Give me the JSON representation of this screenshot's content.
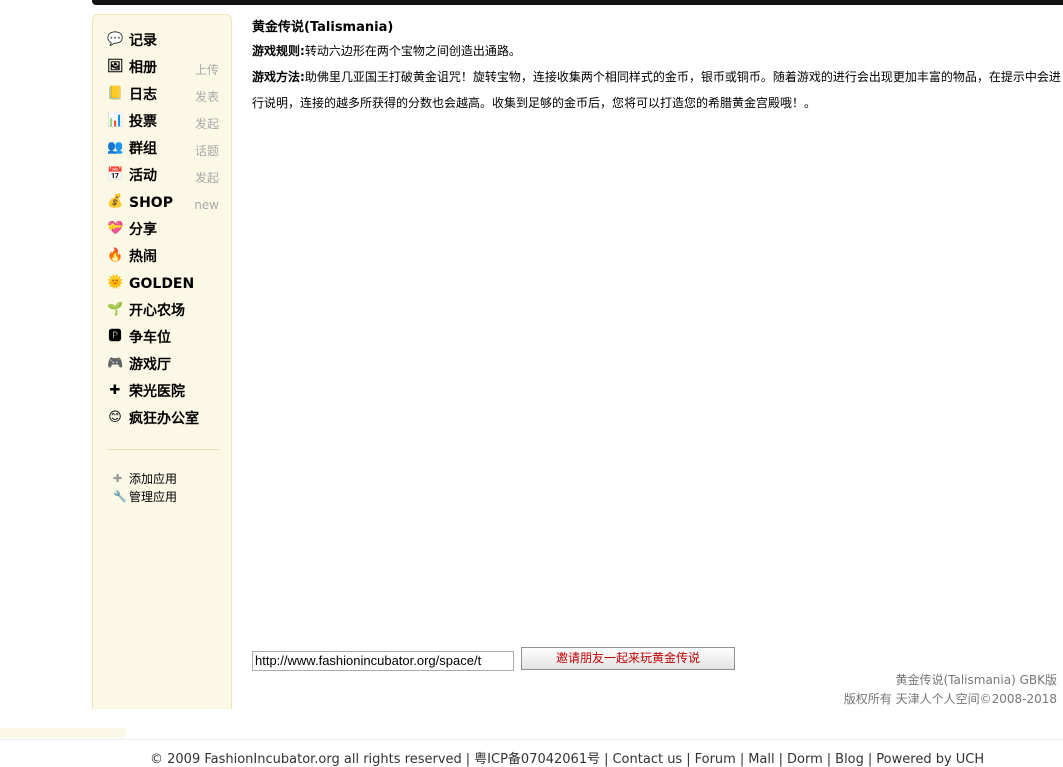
{
  "sidebar": {
    "items": [
      {
        "label": "记录",
        "sub": "",
        "icon": "chat-bubble-icon",
        "glyph": "💬"
      },
      {
        "label": "相册",
        "sub": "上传",
        "icon": "photo-icon",
        "glyph": "🖼"
      },
      {
        "label": "日志",
        "sub": "发表",
        "icon": "notebook-icon",
        "glyph": "📒"
      },
      {
        "label": "投票",
        "sub": "发起",
        "icon": "bar-chart-icon",
        "glyph": "📊"
      },
      {
        "label": "群组",
        "sub": "话题",
        "icon": "group-icon",
        "glyph": "👥"
      },
      {
        "label": "活动",
        "sub": "发起",
        "icon": "calendar-icon",
        "glyph": "📅"
      },
      {
        "label": "SHOP",
        "sub": "new",
        "icon": "coins-icon",
        "glyph": "💰"
      },
      {
        "label": "分享",
        "sub": "",
        "icon": "heart-icon",
        "glyph": "💝"
      },
      {
        "label": "热闹",
        "sub": "",
        "icon": "fire-icon",
        "glyph": "🔥"
      },
      {
        "label": "GOLDEN",
        "sub": "",
        "icon": "sun-icon",
        "glyph": "🌞"
      },
      {
        "label": "开心农场",
        "sub": "",
        "icon": "sprout-icon",
        "glyph": "🌱"
      },
      {
        "label": "争车位",
        "sub": "",
        "icon": "parking-icon",
        "glyph": "🅿"
      },
      {
        "label": "游戏厅",
        "sub": "",
        "icon": "gamepad-icon",
        "glyph": "🎮"
      },
      {
        "label": "荣光医院",
        "sub": "",
        "icon": "red-cross-icon",
        "glyph": "✚"
      },
      {
        "label": "疯狂办公室",
        "sub": "",
        "icon": "face-icon",
        "glyph": "😊"
      }
    ],
    "add_app": "添加应用",
    "manage_app": "管理应用"
  },
  "main": {
    "title": "黄金传说(Talismania)",
    "rules_label": "游戏规则:",
    "rules_text": "转动六边形在两个宝物之间创造出通路。",
    "method_label": "游戏方法:",
    "method_text": "助佛里几亚国王打破黄金诅咒！旋转宝物，连接收集两个相同样式的金币，银币或铜币。随着游戏的进行会出现更加丰富的物品，在提示中会进行说明，连接的越多所获得的分数也会越高。收集到足够的金币后，您将可以打造您的希腊黄金宫殿哦！。"
  },
  "invite": {
    "url": "http://www.fashionincubator.org/space/t",
    "button": "邀请朋友一起来玩黄金传说"
  },
  "credit": {
    "line1": "黄金传说(Talismania) GBK版",
    "line2": "版权所有  天津人个人空间©2008-2018"
  },
  "footer": {
    "copyright": "© 2009 FashionIncubator.org all rights reserved",
    "icp": "粤ICP备07042061号",
    "links": [
      "Contact us",
      "Forum",
      "Mall",
      "Dorm",
      "Blog"
    ],
    "powered": "Powered by UCH"
  }
}
